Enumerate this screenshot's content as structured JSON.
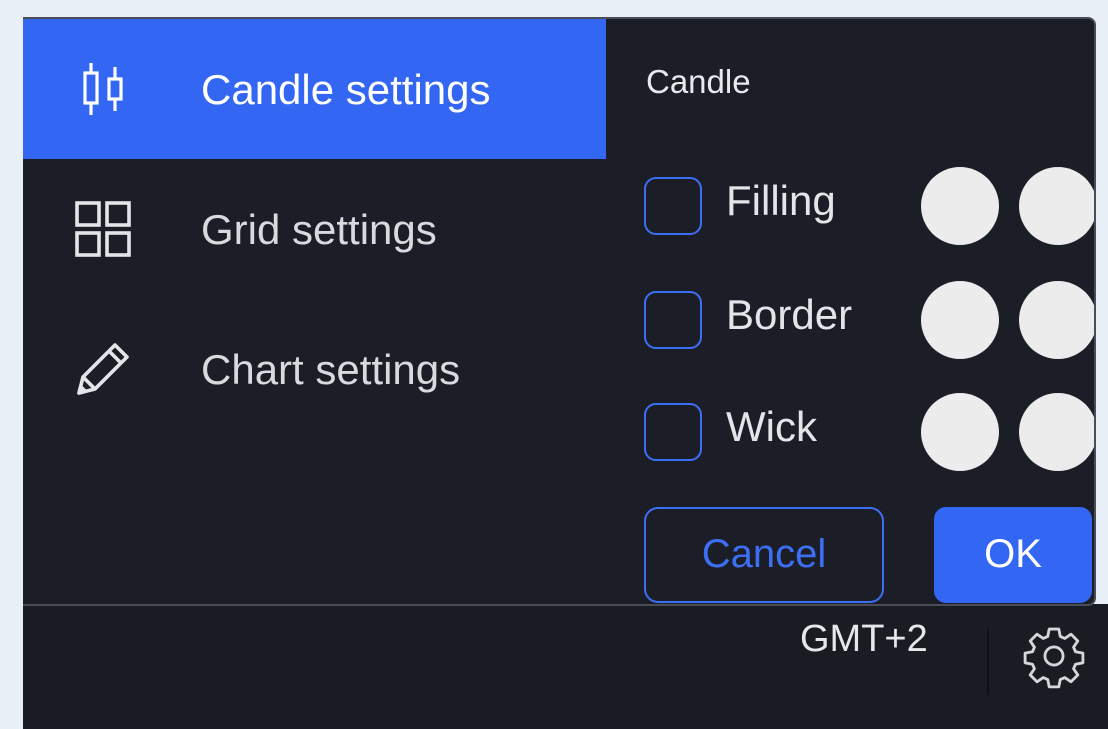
{
  "sidebar": {
    "items": [
      {
        "label": "Candle settings",
        "icon": "candlestick-icon",
        "active": true
      },
      {
        "label": "Grid settings",
        "icon": "grid-icon",
        "active": false
      },
      {
        "label": "Chart settings",
        "icon": "pencil-icon",
        "active": false
      }
    ]
  },
  "panel": {
    "title": "Candle",
    "options": [
      {
        "label": "Filling",
        "checked": false
      },
      {
        "label": "Border",
        "checked": false
      },
      {
        "label": "Wick",
        "checked": false
      }
    ],
    "cancel_label": "Cancel",
    "ok_label": "OK"
  },
  "status_bar": {
    "timezone": "GMT+2",
    "settings_icon": "gear-icon"
  },
  "colors": {
    "accent": "#3366f2",
    "dialog_bg": "#1c1e27",
    "swatch": "#ececec"
  }
}
